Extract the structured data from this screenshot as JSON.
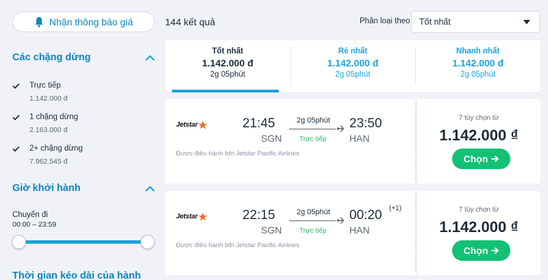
{
  "sidebar": {
    "notify_label": "Nhận thông báo giá",
    "stops_section": {
      "title": "Các chặng dừng",
      "items": [
        {
          "label": "Trực tiếp",
          "price": "1.142.000 đ",
          "checked": true
        },
        {
          "label": "1 chặng dừng",
          "price": "2.163.000 đ",
          "checked": true
        },
        {
          "label": "2+ chặng dừng",
          "price": "7.962.545 đ",
          "checked": true
        }
      ]
    },
    "departure_section": {
      "title": "Giờ khởi hành",
      "trip_label": "Chuyến đi",
      "range": "00:00 – 23:59"
    },
    "duration_section": {
      "title": "Thời gian kéo dài của hành"
    }
  },
  "results": {
    "count": "144 kết quả",
    "sort_label": "Phân loại theo",
    "sort_value": "Tốt nhất"
  },
  "tabs": [
    {
      "title": "Tốt nhất",
      "price": "1.142.000 đ",
      "duration": "2g 05phút",
      "active": true
    },
    {
      "title": "Rẻ nhất",
      "price": "1.142.000 đ",
      "duration": "2g 05phút",
      "active": false
    },
    {
      "title": "Nhanh nhất",
      "price": "1.142.000 đ",
      "duration": "2g 05phút",
      "active": false
    }
  ],
  "flights": [
    {
      "airline": "Jetstar",
      "dep_time": "21:45",
      "dep_code": "SGN",
      "arr_time": "23:50",
      "arr_code": "HAN",
      "plus_day": "",
      "duration": "2g 05phút",
      "stops": "Trực tiếp",
      "operated_by": "Được điều hành bởi Jetstar Pacific Airlines",
      "options": "7 tùy chọn từ",
      "price": "1.142.000 ₫",
      "cta": "Chọn"
    },
    {
      "airline": "Jetstar",
      "dep_time": "22:15",
      "dep_code": "SGN",
      "arr_time": "00:20",
      "arr_code": "HAN",
      "plus_day": "(+1)",
      "duration": "2g 05phút",
      "stops": "Trực tiếp",
      "operated_by": "Được điều hành bởi Jetstar Pacific Airlines",
      "options": "7 tùy chọn từ",
      "price": "1.142.000 ₫",
      "cta": "Chọn"
    }
  ],
  "colors": {
    "accent": "#1aa3d9",
    "heading": "#0b86c2",
    "cta": "#12c174",
    "direct": "#2cb46a",
    "background": "#f1f2f8"
  }
}
